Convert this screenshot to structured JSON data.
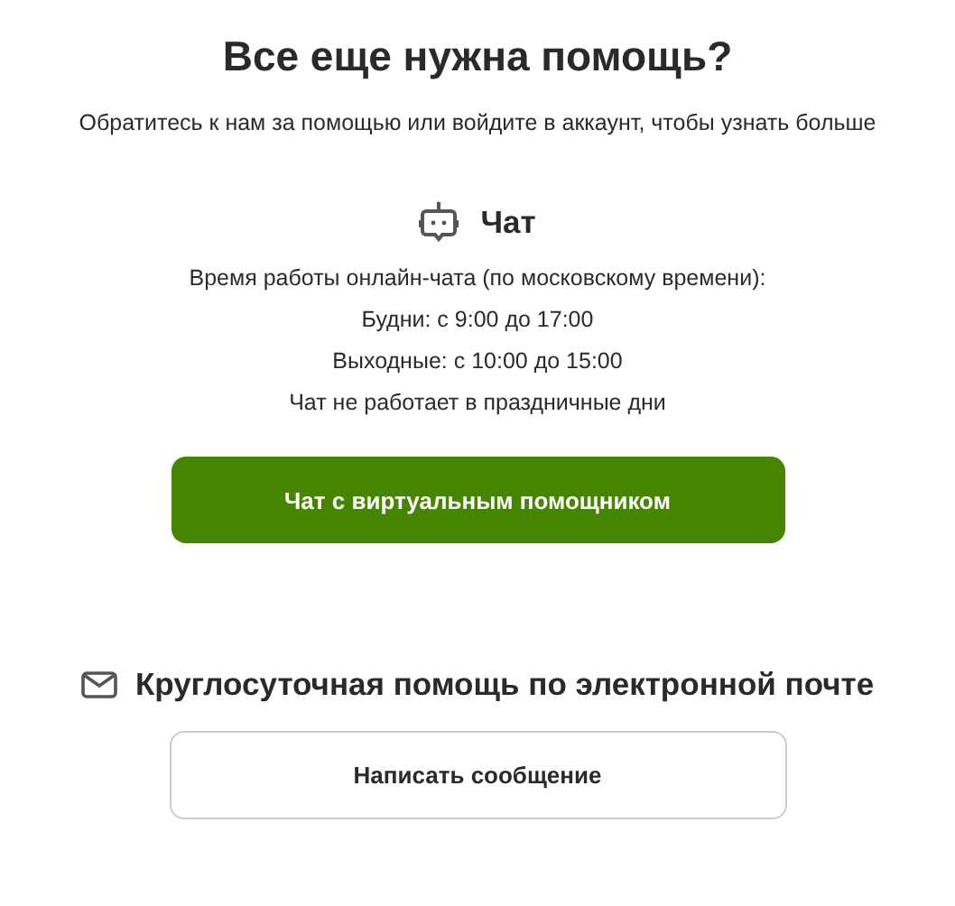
{
  "title": "Все еще нужна помощь?",
  "subtitle": "Обратитесь к нам за помощью или войдите в аккаунт, чтобы узнать больше",
  "chat": {
    "heading": "Чат",
    "hours": [
      "Время работы онлайн-чата (по московскому времени):",
      "Будни: с 9:00 до 17:00",
      "Выходные: с 10:00 до 15:00",
      "Чат не работает в праздничные дни"
    ],
    "button": "Чат с виртуальным помощником"
  },
  "email": {
    "heading": "Круглосуточная помощь по электронной почте",
    "button": "Написать сообщение"
  }
}
